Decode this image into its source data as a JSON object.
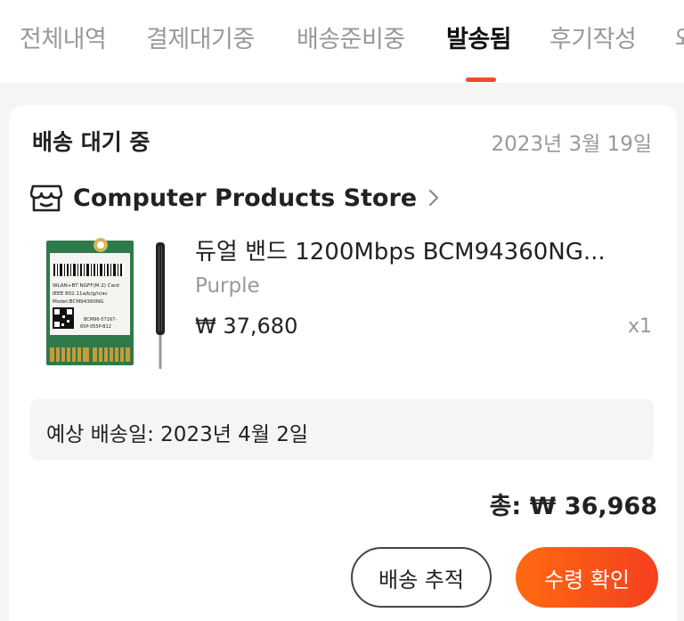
{
  "tabs": [
    {
      "label": "전체내역",
      "active": false
    },
    {
      "label": "결제대기중",
      "active": false
    },
    {
      "label": "배송준비중",
      "active": false
    },
    {
      "label": "발송됨",
      "active": true
    },
    {
      "label": "후기작성",
      "active": false
    },
    {
      "label": "와",
      "active": false
    }
  ],
  "colors": {
    "accent": "#f04a2c",
    "confirm_gradient_start": "#ff6a10",
    "confirm_gradient_end": "#f5401f"
  },
  "order": {
    "status": "배송 대기 중",
    "date": "2023년 3월 19일",
    "store": {
      "name": "Computer Products Store",
      "icon": "store-icon"
    },
    "product": {
      "title": "듀얼 밴드 1200Mbps BCM94360NG...",
      "variant": "Purple",
      "price": "₩ 37,680",
      "quantity": "x1",
      "image_text": {
        "line1": "WLAN+BT NGFF(M.2) Card",
        "line2": "IEEE 802.11a/b/g/n/ac",
        "line3": "Model:BCM94360NG",
        "line4": "BCM96-57167-",
        "line5": "65P-055P-B12"
      }
    },
    "estimated_delivery": "예상 배송일: 2023년 4월 2일",
    "total": "총: ₩ 36,968"
  },
  "actions": {
    "track_label": "배송 추적",
    "confirm_label": "수령 확인"
  }
}
